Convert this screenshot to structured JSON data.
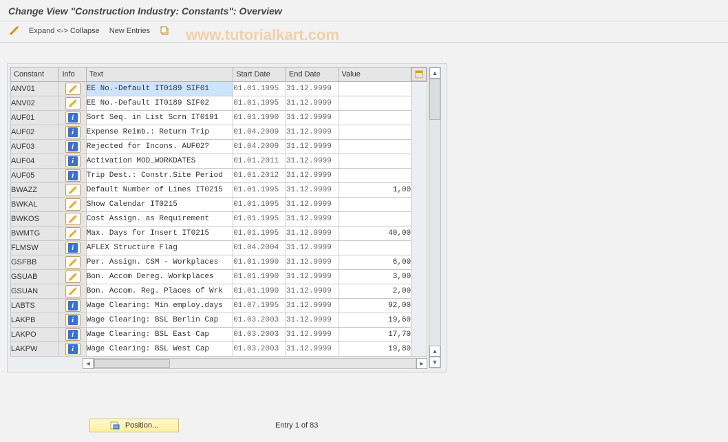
{
  "title": "Change View \"Construction Industry: Constants\": Overview",
  "watermark": "www.tutorialkart.com",
  "toolbar": {
    "expand_collapse": "Expand <-> Collapse",
    "new_entries": "New Entries"
  },
  "columns": {
    "constant": "Constant",
    "info": "Info",
    "text": "Text",
    "start": "Start Date",
    "end": "End Date",
    "value": "Value"
  },
  "footer": {
    "position_label": "Position...",
    "entry_text": "Entry 1 of 83"
  },
  "rows": [
    {
      "constant": "ANV01",
      "info": "pencil",
      "text": "EE No.-Default IT0189 SIF01",
      "start": "01.01.1995",
      "end": "31.12.9999",
      "value": "",
      "selected": true
    },
    {
      "constant": "ANV02",
      "info": "pencil",
      "text": "EE No.-Default IT0189 SIF02",
      "start": "01.01.1995",
      "end": "31.12.9999",
      "value": ""
    },
    {
      "constant": "AUF01",
      "info": "info",
      "text": "Sort Seq. in List Scrn IT0191",
      "start": "01.01.1990",
      "end": "31.12.9999",
      "value": ""
    },
    {
      "constant": "AUF02",
      "info": "info",
      "text": "Expense Reimb.: Return Trip",
      "start": "01.04.2009",
      "end": "31.12.9999",
      "value": ""
    },
    {
      "constant": "AUF03",
      "info": "info",
      "text": "Rejected for Incons. AUF02?",
      "start": "01.04.2009",
      "end": "31.12.9999",
      "value": ""
    },
    {
      "constant": "AUF04",
      "info": "info",
      "text": "Activation MOD_WORKDATES",
      "start": "01.01.2011",
      "end": "31.12.9999",
      "value": ""
    },
    {
      "constant": "AUF05",
      "info": "info",
      "text": "Trip Dest.: Constr.Site Period",
      "start": "01.01.2012",
      "end": "31.12.9999",
      "value": ""
    },
    {
      "constant": "BWAZZ",
      "info": "pencil",
      "text": "Default Number of Lines IT0215",
      "start": "01.01.1995",
      "end": "31.12.9999",
      "value": "1,00"
    },
    {
      "constant": "BWKAL",
      "info": "pencil",
      "text": "Show Calendar        IT0215",
      "start": "01.01.1995",
      "end": "31.12.9999",
      "value": ""
    },
    {
      "constant": "BWKOS",
      "info": "pencil",
      "text": "Cost Assign. as Requirement",
      "start": "01.01.1995",
      "end": "31.12.9999",
      "value": ""
    },
    {
      "constant": "BWMTG",
      "info": "pencil",
      "text": "Max. Days for Insert  IT0215",
      "start": "01.01.1995",
      "end": "31.12.9999",
      "value": "40,00"
    },
    {
      "constant": "FLMSW",
      "info": "info",
      "text": "AFLEX Structure Flag",
      "start": "01.04.2004",
      "end": "31.12.9999",
      "value": ""
    },
    {
      "constant": "GSFBB",
      "info": "pencil",
      "text": "Per. Assign. CSM - Workplaces",
      "start": "01.01.1990",
      "end": "31.12.9999",
      "value": "6,00"
    },
    {
      "constant": "GSUAB",
      "info": "pencil",
      "text": "Bon. Accom  Dereg. Workplaces",
      "start": "01.01.1990",
      "end": "31.12.9999",
      "value": "3,00"
    },
    {
      "constant": "GSUAN",
      "info": "pencil",
      "text": "Bon. Accom. Reg. Places of Wrk",
      "start": "01.01.1990",
      "end": "31.12.9999",
      "value": "2,00"
    },
    {
      "constant": "LABTS",
      "info": "info",
      "text": "Wage Clearing: Min employ.days",
      "start": "01.07.1995",
      "end": "31.12.9999",
      "value": "92,00"
    },
    {
      "constant": "LAKPB",
      "info": "info",
      "text": "Wage Clearing: BSL Berlin Cap",
      "start": "01.03.2003",
      "end": "31.12.9999",
      "value": "19,60"
    },
    {
      "constant": "LAKPO",
      "info": "info",
      "text": "Wage Clearing: BSL East Cap",
      "start": "01.03.2003",
      "end": "31.12.9999",
      "value": "17,70"
    },
    {
      "constant": "LAKPW",
      "info": "info",
      "text": "Wage Clearing: BSL West Cap",
      "start": "01.03.2003",
      "end": "31.12.9999",
      "value": "19,80"
    }
  ]
}
